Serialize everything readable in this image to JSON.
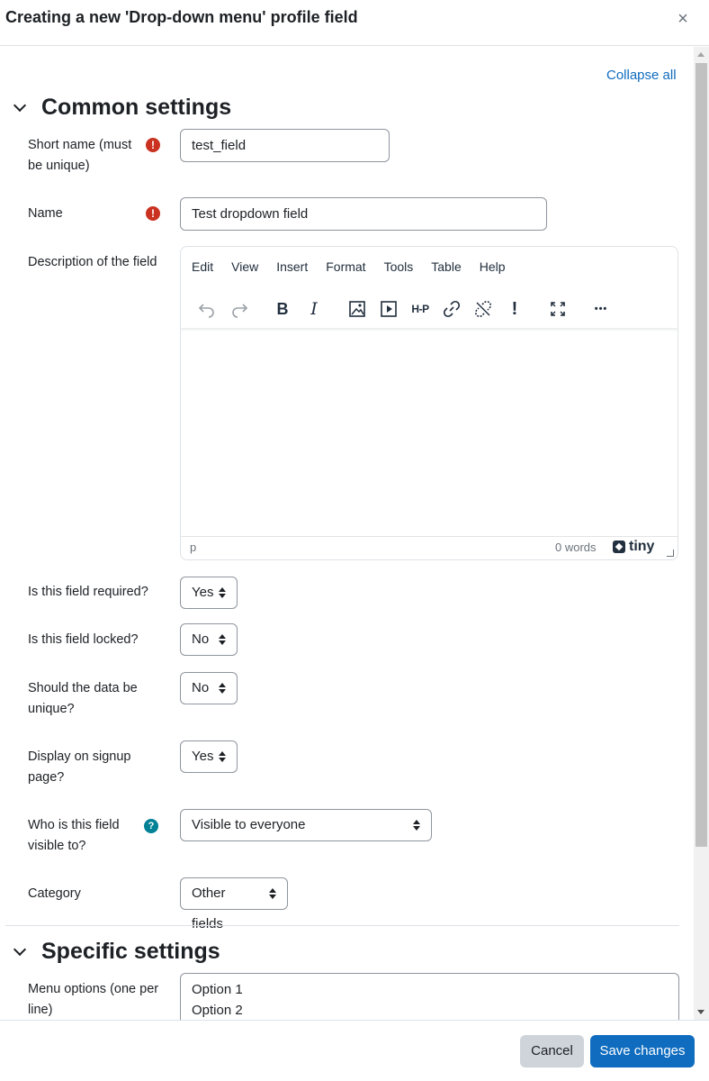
{
  "header": {
    "title": "Creating a new 'Drop-down menu' profile field",
    "close_glyph": "×"
  },
  "collapse_all": "Collapse all",
  "sections": {
    "common": "Common settings",
    "specific": "Specific settings"
  },
  "fields": {
    "short_name": {
      "label": "Short name (must be unique)",
      "value": "test_field",
      "required": true
    },
    "name": {
      "label": "Name",
      "value": "Test dropdown field",
      "required": true
    },
    "description": {
      "label": "Description of the field"
    },
    "required": {
      "label": "Is this field required?",
      "value": "Yes"
    },
    "locked": {
      "label": "Is this field locked?",
      "value": "No"
    },
    "unique": {
      "label": "Should the data be unique?",
      "value": "No"
    },
    "signup": {
      "label": "Display on signup page?",
      "value": "Yes"
    },
    "visible": {
      "label": "Who is this field visible to?",
      "value": "Visible to everyone",
      "help": true
    },
    "category": {
      "label": "Category",
      "value": "Other fields"
    },
    "menu_options": {
      "label": "Menu options (one per line)",
      "lines": [
        "Option 1",
        "Option 2"
      ]
    }
  },
  "editor": {
    "menu": [
      "Edit",
      "View",
      "Insert",
      "Format",
      "Tools",
      "Table",
      "Help"
    ],
    "toolbar_icons": [
      "undo-icon",
      "redo-icon",
      "bold-icon",
      "italic-icon",
      "image-icon",
      "media-icon",
      "h5p-icon",
      "link-icon",
      "unlink-icon",
      "accessibility-icon",
      "fullscreen-icon",
      "more-icon"
    ],
    "bold_glyph": "B",
    "italic_glyph": "I",
    "h5p_glyph": "H-P",
    "exclaim_glyph": "!",
    "more_glyph": "•••",
    "status_path": "p",
    "status_words": "0 words",
    "brand": "tiny"
  },
  "icons": {
    "required_glyph": "!",
    "help_glyph": "?"
  },
  "footer": {
    "cancel": "Cancel",
    "save": "Save changes"
  },
  "colors": {
    "primary": "#0f6cbf",
    "required": "#ca3120",
    "help": "#008196",
    "secondary_button": "#ced4da"
  }
}
